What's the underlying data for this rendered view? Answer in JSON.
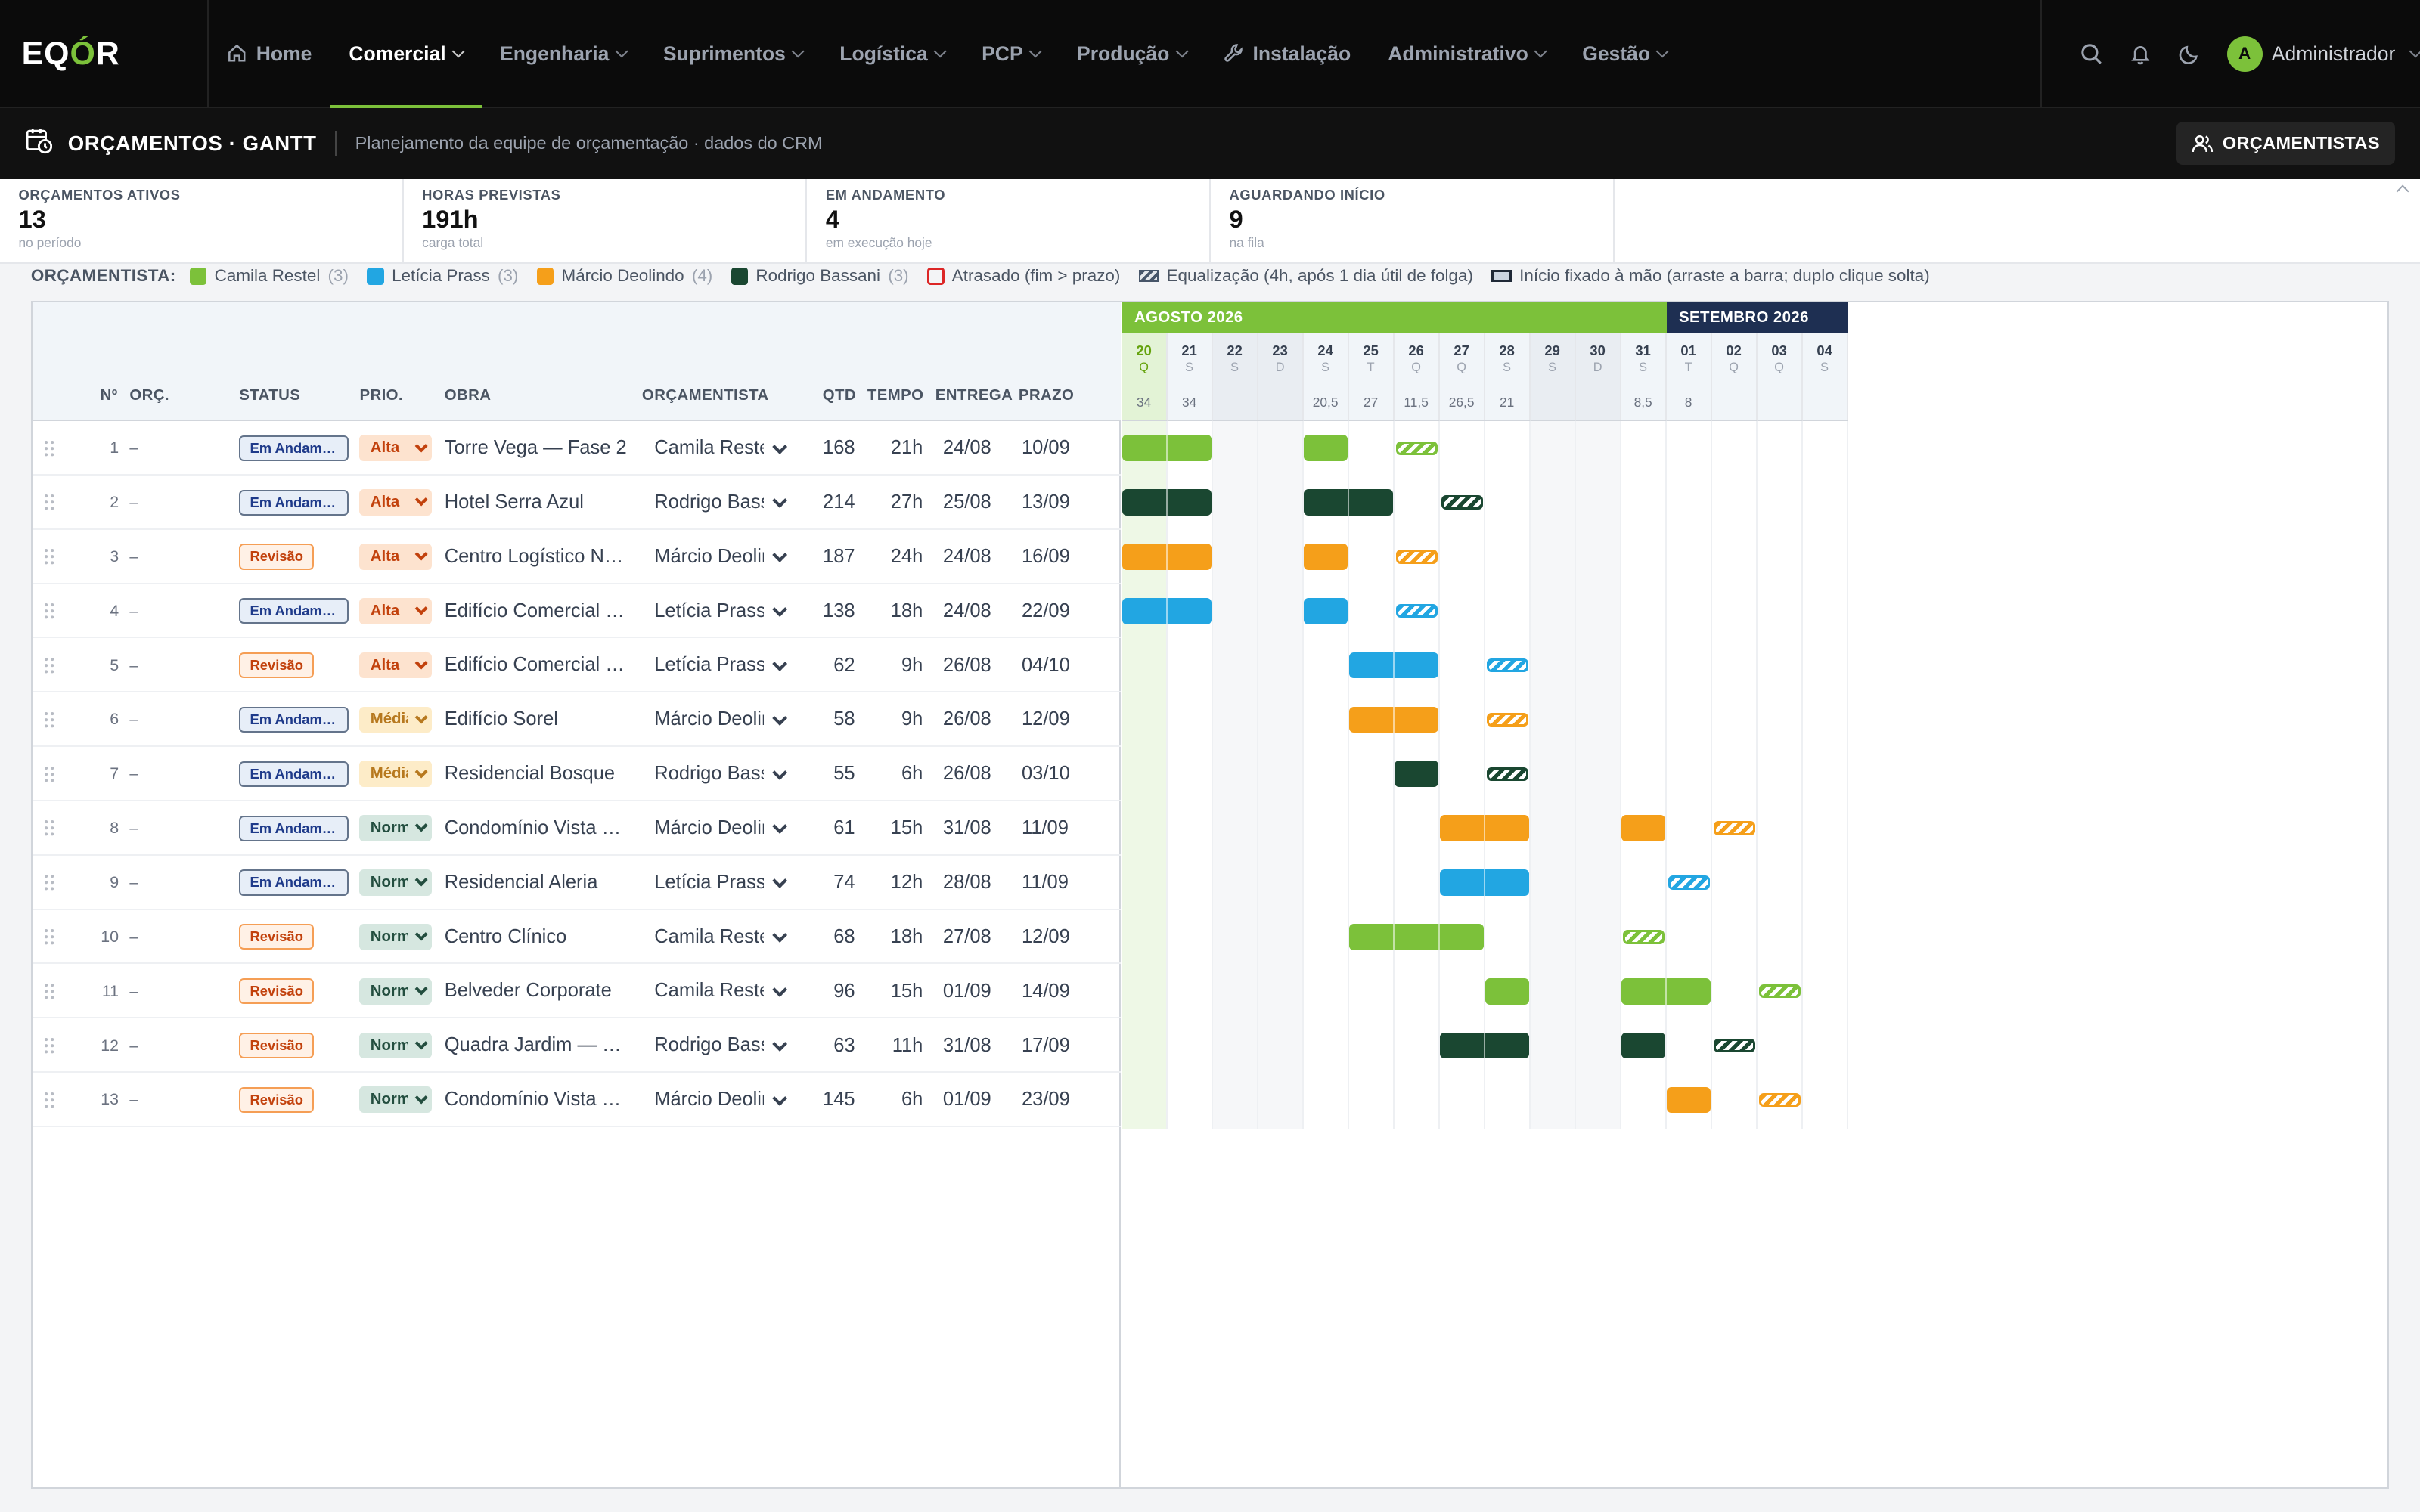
{
  "app": {
    "logo_a": "EQ",
    "logo_b": "Ó",
    "logo_c": "R"
  },
  "nav": {
    "items": [
      {
        "label": "Home",
        "icon": "home-icon",
        "dropdown": false,
        "active": false
      },
      {
        "label": "Comercial",
        "dropdown": true,
        "active": true
      },
      {
        "label": "Engenharia",
        "dropdown": true,
        "active": false
      },
      {
        "label": "Suprimentos",
        "dropdown": true,
        "active": false
      },
      {
        "label": "Logística",
        "dropdown": true,
        "active": false
      },
      {
        "label": "PCP",
        "dropdown": true,
        "active": false
      },
      {
        "label": "Produção",
        "dropdown": true,
        "active": false
      },
      {
        "label": "Instalação",
        "icon": "wrench-icon",
        "dropdown": false,
        "active": false
      },
      {
        "label": "Administrativo",
        "dropdown": true,
        "active": false
      },
      {
        "label": "Gestão",
        "dropdown": true,
        "active": false
      }
    ],
    "user_initial": "A",
    "user_name": "Administrador"
  },
  "page": {
    "title": "ORÇAMENTOS · GANTT",
    "subtitle": "Planejamento da equipe de orçamentação · dados do CRM",
    "orc_button": "ORÇAMENTISTAS"
  },
  "kpis": [
    {
      "label": "ORÇAMENTOS ATIVOS",
      "value": "13",
      "sub": "no período"
    },
    {
      "label": "HORAS PREVISTAS",
      "value": "191h",
      "sub": "carga total"
    },
    {
      "label": "EM ANDAMENTO",
      "value": "4",
      "sub": "em execução hoje"
    },
    {
      "label": "AGUARDANDO INÍCIO",
      "value": "9",
      "sub": "na fila"
    }
  ],
  "legend": {
    "title": "ORÇAMENTISTA:",
    "people": [
      {
        "name": "Camila Restel",
        "count": "(3)",
        "color": "#7cc13a"
      },
      {
        "name": "Letícia Prass",
        "count": "(3)",
        "color": "#22a6e2"
      },
      {
        "name": "Márcio Deolindo",
        "count": "(4)",
        "color": "#f59f1a"
      },
      {
        "name": "Rodrigo Bassani",
        "count": "(3)",
        "color": "#1a4731"
      }
    ],
    "late": "Atrasado (fim > prazo)",
    "equal": "Equalização (4h, após 1 dia útil de folga)",
    "fixed": "Início fixado à mão (arraste a barra; duplo clique solta)"
  },
  "columns": {
    "n": "Nº",
    "orc": "ORÇ.",
    "status": "STATUS",
    "prio": "PRIO.",
    "obra": "OBRA",
    "orcamentista": "ORÇAMENTISTA",
    "qtd": "QTD",
    "tempo": "TEMPO",
    "entrega": "ENTREGA",
    "prazo": "PRAZO"
  },
  "months": [
    {
      "label": "AGOSTO 2026",
      "color": "#7cc13a",
      "days": 12
    },
    {
      "label": "SETEMBRO 2026",
      "color": "#1e2f52",
      "days": 4
    }
  ],
  "days": [
    {
      "d": "20",
      "w": "Q",
      "h": "34",
      "type": "today"
    },
    {
      "d": "21",
      "w": "S",
      "h": "34",
      "type": ""
    },
    {
      "d": "22",
      "w": "S",
      "h": "",
      "type": "we"
    },
    {
      "d": "23",
      "w": "D",
      "h": "",
      "type": "we"
    },
    {
      "d": "24",
      "w": "S",
      "h": "20,5",
      "type": ""
    },
    {
      "d": "25",
      "w": "T",
      "h": "27",
      "type": ""
    },
    {
      "d": "26",
      "w": "Q",
      "h": "11,5",
      "type": ""
    },
    {
      "d": "27",
      "w": "Q",
      "h": "26,5",
      "type": ""
    },
    {
      "d": "28",
      "w": "S",
      "h": "21",
      "type": ""
    },
    {
      "d": "29",
      "w": "S",
      "h": "",
      "type": "we"
    },
    {
      "d": "30",
      "w": "D",
      "h": "",
      "type": "we"
    },
    {
      "d": "31",
      "w": "S",
      "h": "8,5",
      "type": ""
    },
    {
      "d": "01",
      "w": "T",
      "h": "8",
      "type": ""
    },
    {
      "d": "02",
      "w": "Q",
      "h": "",
      "type": ""
    },
    {
      "d": "03",
      "w": "Q",
      "h": "",
      "type": ""
    },
    {
      "d": "04",
      "w": "S",
      "h": "",
      "type": ""
    }
  ],
  "rows": [
    {
      "n": "1",
      "orc": "–",
      "status": "Em Andamento",
      "stype": "and",
      "prio": "Alta",
      "ptype": "alta",
      "obra": "Torre Vega — Fase 2",
      "orcamentista": "Camila Restel",
      "qtd": "168",
      "tempo": "21h",
      "entrega": "24/08",
      "prazo": "10/09",
      "bars": [
        [
          0,
          2
        ],
        [
          4,
          1
        ]
      ],
      "equal_day": 6
    },
    {
      "n": "2",
      "orc": "–",
      "status": "Em Andamento",
      "stype": "and",
      "prio": "Alta",
      "ptype": "alta",
      "obra": "Hotel Serra Azul",
      "orcamentista": "Rodrigo Bassani",
      "qtd": "214",
      "tempo": "27h",
      "entrega": "25/08",
      "prazo": "13/09",
      "bars": [
        [
          0,
          2
        ],
        [
          4,
          2
        ]
      ],
      "equal_day": 7
    },
    {
      "n": "3",
      "orc": "–",
      "status": "Revisão",
      "stype": "rev",
      "prio": "Alta",
      "ptype": "alta",
      "obra": "Centro Logístico Norte",
      "orcamentista": "Márcio Deolindo",
      "qtd": "187",
      "tempo": "24h",
      "entrega": "24/08",
      "prazo": "16/09",
      "bars": [
        [
          0,
          2
        ],
        [
          4,
          1
        ]
      ],
      "equal_day": 6
    },
    {
      "n": "4",
      "orc": "–",
      "status": "Em Andamento",
      "stype": "and",
      "prio": "Alta",
      "ptype": "alta",
      "obra": "Edifício Comercial Praça",
      "orcamentista": "Letícia Prass",
      "qtd": "138",
      "tempo": "18h",
      "entrega": "24/08",
      "prazo": "22/09",
      "bars": [
        [
          0,
          2
        ],
        [
          4,
          1
        ]
      ],
      "equal_day": 6
    },
    {
      "n": "5",
      "orc": "–",
      "status": "Revisão",
      "stype": "rev",
      "prio": "Alta",
      "ptype": "alta",
      "obra": "Edifício Comercial Praça",
      "orcamentista": "Letícia Prass",
      "qtd": "62",
      "tempo": "9h",
      "entrega": "26/08",
      "prazo": "04/10",
      "bars": [
        [
          5,
          2
        ]
      ],
      "equal_day": 8
    },
    {
      "n": "6",
      "orc": "–",
      "status": "Em Andamento",
      "stype": "and",
      "prio": "Média",
      "ptype": "med",
      "obra": "Edifício Sorel",
      "orcamentista": "Márcio Deolindo",
      "qtd": "58",
      "tempo": "9h",
      "entrega": "26/08",
      "prazo": "12/09",
      "bars": [
        [
          5,
          2
        ]
      ],
      "equal_day": 8
    },
    {
      "n": "7",
      "orc": "–",
      "status": "Em Andamento",
      "stype": "and",
      "prio": "Média",
      "ptype": "med",
      "obra": "Residencial Bosque",
      "orcamentista": "Rodrigo Bassani",
      "qtd": "55",
      "tempo": "6h",
      "entrega": "26/08",
      "prazo": "03/10",
      "bars": [
        [
          6,
          1
        ]
      ],
      "equal_day": 8
    },
    {
      "n": "8",
      "orc": "–",
      "status": "Em Andamento",
      "stype": "and",
      "prio": "Normal",
      "ptype": "norm",
      "obra": "Condomínio Vista Mar",
      "orcamentista": "Márcio Deolindo",
      "qtd": "61",
      "tempo": "15h",
      "entrega": "31/08",
      "prazo": "11/09",
      "bars": [
        [
          7,
          2
        ],
        [
          11,
          1
        ]
      ],
      "equal_day": 13
    },
    {
      "n": "9",
      "orc": "–",
      "status": "Em Andamento",
      "stype": "and",
      "prio": "Normal",
      "ptype": "norm",
      "obra": "Residencial Aleria",
      "orcamentista": "Letícia Prass",
      "qtd": "74",
      "tempo": "12h",
      "entrega": "28/08",
      "prazo": "11/09",
      "bars": [
        [
          7,
          2
        ]
      ],
      "equal_day": 12
    },
    {
      "n": "10",
      "orc": "–",
      "status": "Revisão",
      "stype": "rev",
      "prio": "Normal",
      "ptype": "norm",
      "obra": "Centro Clínico",
      "orcamentista": "Camila Restel",
      "qtd": "68",
      "tempo": "18h",
      "entrega": "27/08",
      "prazo": "12/09",
      "bars": [
        [
          5,
          3
        ]
      ],
      "equal_day": 11
    },
    {
      "n": "11",
      "orc": "–",
      "status": "Revisão",
      "stype": "rev",
      "prio": "Normal",
      "ptype": "norm",
      "obra": "Belveder Corporate",
      "orcamentista": "Camila Restel",
      "qtd": "96",
      "tempo": "15h",
      "entrega": "01/09",
      "prazo": "14/09",
      "bars": [
        [
          8,
          1
        ],
        [
          11,
          2
        ]
      ],
      "equal_day": 14
    },
    {
      "n": "12",
      "orc": "–",
      "status": "Revisão",
      "stype": "rev",
      "prio": "Normal",
      "ptype": "norm",
      "obra": "Quadra Jardim — Bloco B",
      "orcamentista": "Rodrigo Bassani",
      "qtd": "63",
      "tempo": "11h",
      "entrega": "31/08",
      "prazo": "17/09",
      "bars": [
        [
          7,
          2
        ],
        [
          11,
          1
        ]
      ],
      "equal_day": 13
    },
    {
      "n": "13",
      "orc": "–",
      "status": "Revisão",
      "stype": "rev",
      "prio": "Normal",
      "ptype": "norm",
      "obra": "Condomínio Vista Mar",
      "orcamentista": "Márcio Deolindo",
      "qtd": "145",
      "tempo": "6h",
      "entrega": "01/09",
      "prazo": "23/09",
      "bars": [
        [
          12,
          1
        ]
      ],
      "equal_day": 14
    }
  ],
  "colors": {
    "Camila Restel": "#7cc13a",
    "Letícia Prass": "#22a6e2",
    "Márcio Deolindo": "#f59f1a",
    "Rodrigo Bassani": "#1a4731"
  }
}
